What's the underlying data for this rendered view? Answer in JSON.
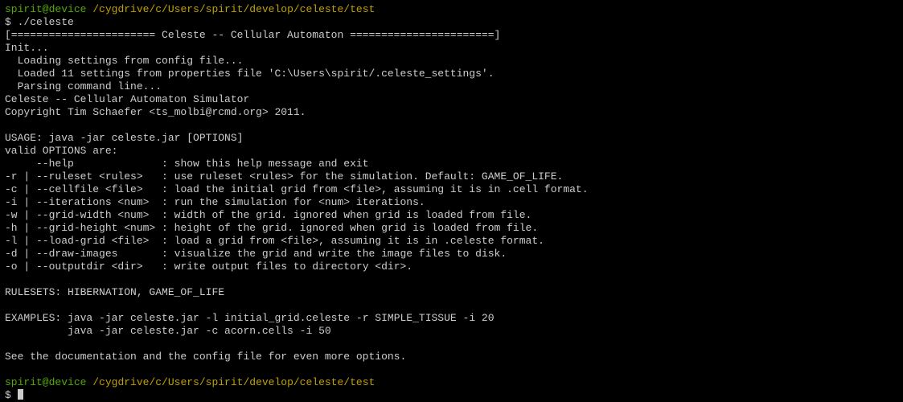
{
  "prompt1": {
    "userhost": "spirit@device",
    "path": "/cygdrive/c/Users/spirit/develop/celeste/test",
    "symbol": "$",
    "command": "./celeste"
  },
  "banner": "[======================= Celeste -- Cellular Automaton =======================]",
  "init_header": "Init...",
  "init_lines": [
    "  Loading settings from config file...",
    "  Loaded 11 settings from properties file 'C:\\Users\\spirit/.celeste_settings'.",
    "  Parsing command line..."
  ],
  "product": "Celeste -- Cellular Automaton Simulator",
  "copyright": "Copyright Tim Schaefer <ts_molbi@rcmd.org> 2011.",
  "usage": "USAGE: java -jar celeste.jar [OPTIONS]",
  "valid_header": "valid OPTIONS are:",
  "options": [
    {
      "flags": "     --help              ",
      "desc": ": show this help message and exit"
    },
    {
      "flags": "-r | --ruleset <rules>   ",
      "desc": ": use ruleset <rules> for the simulation. Default: GAME_OF_LIFE."
    },
    {
      "flags": "-c | --cellfile <file>   ",
      "desc": ": load the initial grid from <file>, assuming it is in .cell format."
    },
    {
      "flags": "-i | --iterations <num>  ",
      "desc": ": run the simulation for <num> iterations."
    },
    {
      "flags": "-w | --grid-width <num>  ",
      "desc": ": width of the grid. ignored when grid is loaded from file."
    },
    {
      "flags": "-h | --grid-height <num> ",
      "desc": ": height of the grid. ignored when grid is loaded from file."
    },
    {
      "flags": "-l | --load-grid <file>  ",
      "desc": ": load a grid from <file>, assuming it is in .celeste format."
    },
    {
      "flags": "-d | --draw-images       ",
      "desc": ": visualize the grid and write the image files to disk."
    },
    {
      "flags": "-o | --outputdir <dir>   ",
      "desc": ": write output files to directory <dir>."
    }
  ],
  "rulesets": "RULESETS: HIBERNATION, GAME_OF_LIFE",
  "examples_label": "EXAMPLES:",
  "examples": [
    "java -jar celeste.jar -l initial_grid.celeste -r SIMPLE_TISSUE -i 20",
    "java -jar celeste.jar -c acorn.cells -i 50"
  ],
  "footer": "See the documentation and the config file for even more options.",
  "prompt2": {
    "userhost": "spirit@device",
    "path": "/cygdrive/c/Users/spirit/develop/celeste/test",
    "symbol": "$"
  }
}
